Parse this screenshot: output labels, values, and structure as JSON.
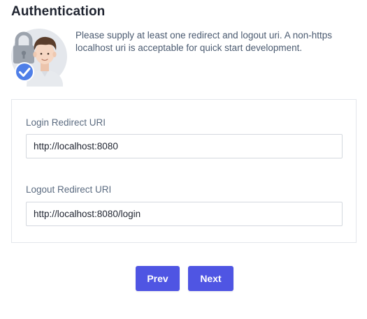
{
  "page": {
    "title": "Authentication",
    "description": "Please supply at least one redirect and logout uri. A non-https localhost uri is acceptable for quick start development."
  },
  "illustration": {
    "icons": [
      "padlock-icon",
      "user-avatar-icon",
      "checkmark-badge-icon"
    ],
    "colors": {
      "background_circle": "#e4e7ec",
      "padlock": "#9ca3ad",
      "hair": "#5a3d2b",
      "skin": "#f6d7c3",
      "shirt": "#e7eaee",
      "badge": "#4f7fe8"
    }
  },
  "form": {
    "login_redirect": {
      "label": "Login Redirect URI",
      "value": "http://localhost:8080"
    },
    "logout_redirect": {
      "label": "Logout Redirect URI",
      "value": "http://localhost:8080/login"
    }
  },
  "actions": {
    "prev_label": "Prev",
    "next_label": "Next"
  },
  "colors": {
    "accent": "#4f55e3",
    "title_text": "#1f2430",
    "body_text": "#4a5a70",
    "panel_border": "#e3e6eb"
  }
}
